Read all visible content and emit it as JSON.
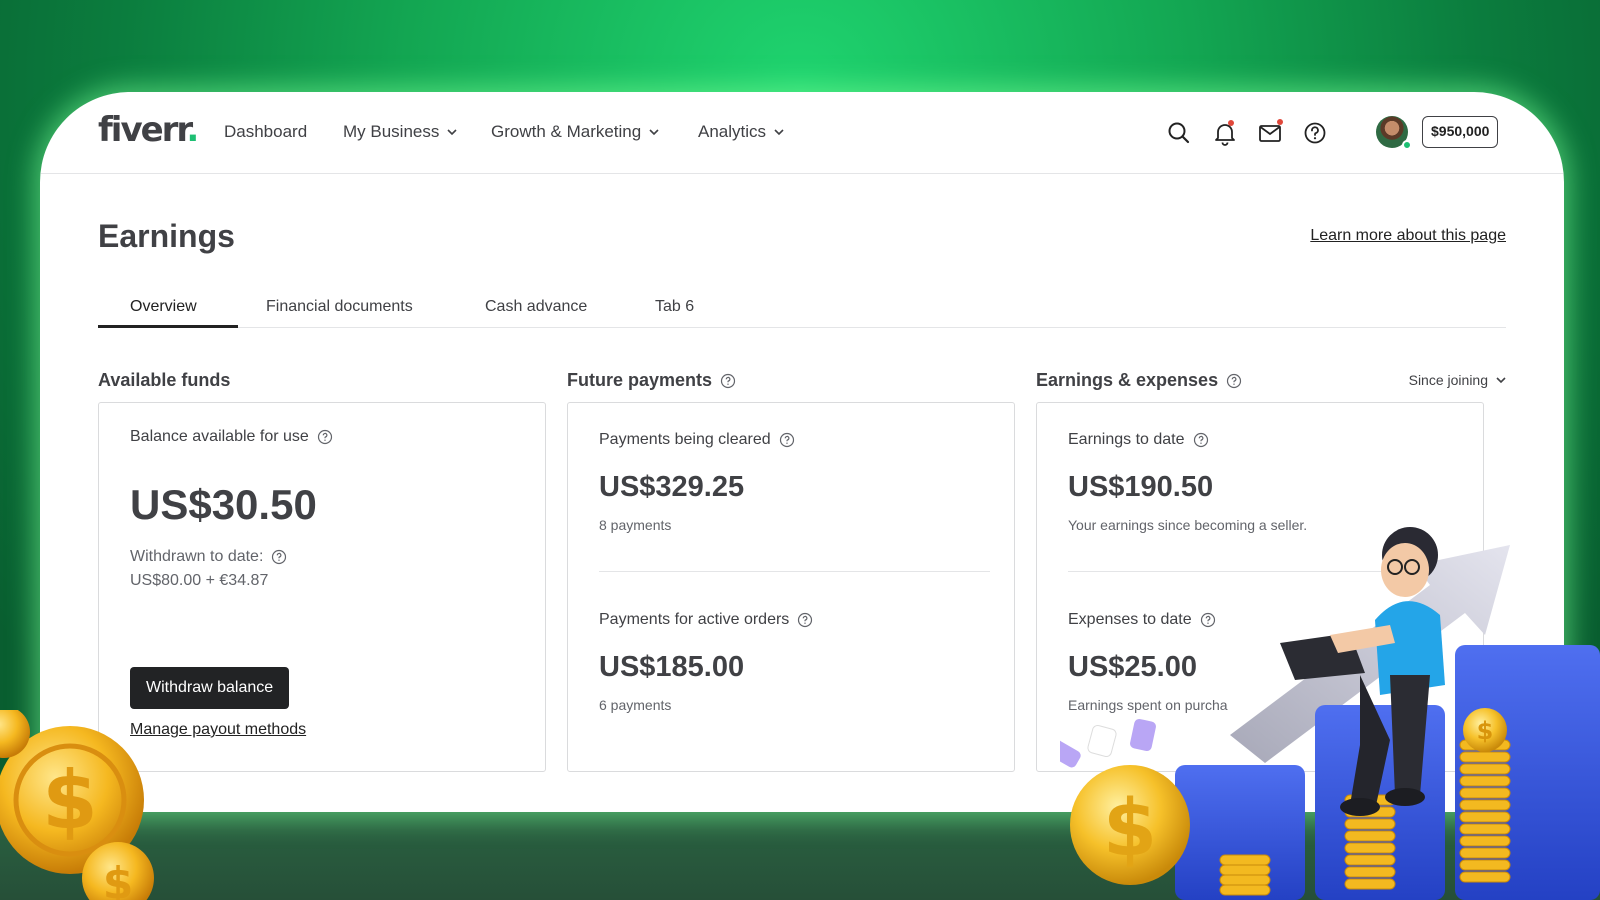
{
  "nav": {
    "logo": "fiverr",
    "logo_dot": ".",
    "items": [
      {
        "label": "Dashboard"
      },
      {
        "label": "My Business"
      },
      {
        "label": "Growth & Marketing"
      },
      {
        "label": "Analytics"
      }
    ],
    "balance": "$950,000"
  },
  "page": {
    "title": "Earnings",
    "learn_more": "Learn more about this page"
  },
  "tabs": [
    {
      "label": "Overview",
      "active": true
    },
    {
      "label": "Financial documents"
    },
    {
      "label": "Cash advance"
    },
    {
      "label": "Tab 6"
    }
  ],
  "available": {
    "title": "Available funds",
    "balance_label": "Balance available for use",
    "balance": "US$30.50",
    "withdrawn_label": "Withdrawn to date:",
    "withdrawn_value": "US$80.00 + €34.87",
    "withdraw_button": "Withdraw balance",
    "manage_link": "Manage payout methods"
  },
  "future": {
    "title": "Future payments",
    "cleared_label": "Payments being cleared",
    "cleared_amount": "US$329.25",
    "cleared_count": "8 payments",
    "active_label": "Payments for active orders",
    "active_amount": "US$185.00",
    "active_count": "6 payments"
  },
  "earnings": {
    "title": "Earnings & expenses",
    "period": "Since joining",
    "earnings_label": "Earnings to date",
    "earnings_amount": "US$190.50",
    "earnings_sub": "Your earnings since becoming a seller.",
    "expenses_label": "Expenses to date",
    "expenses_amount": "US$25.00",
    "expenses_sub": "Earnings spent on purcha"
  },
  "colors": {
    "brand": "#1dbf73",
    "text": "#404145",
    "button": "#222325"
  }
}
